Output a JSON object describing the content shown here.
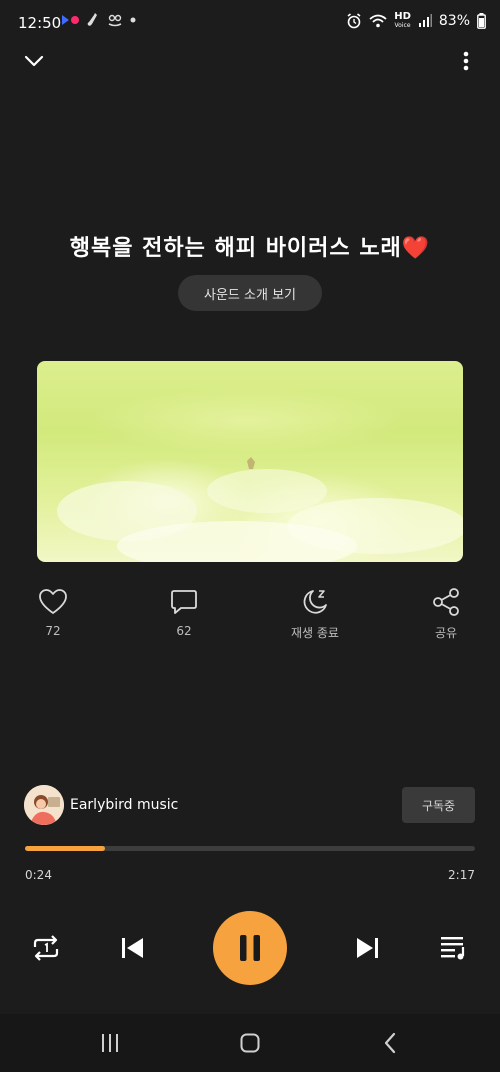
{
  "status": {
    "time": "12:50",
    "hd_label": "HD",
    "hd_sub": "Voice",
    "battery": "83%"
  },
  "track": {
    "title": "행복을 전하는 해피 바이러스 노래",
    "title_emoji": "❤️",
    "intro_button": "사운드 소개 보기"
  },
  "actions": {
    "like_count": "72",
    "comment_count": "62",
    "sleep_label": "재생 종료",
    "share_label": "공유"
  },
  "artist": {
    "name": "Earlybird music",
    "subscribe_label": "구독중"
  },
  "playback": {
    "current_time": "0:24",
    "total_time": "2:17",
    "progress_fraction": 0.177
  },
  "colors": {
    "accent": "#f6a23e",
    "background": "#1c1c1c"
  }
}
